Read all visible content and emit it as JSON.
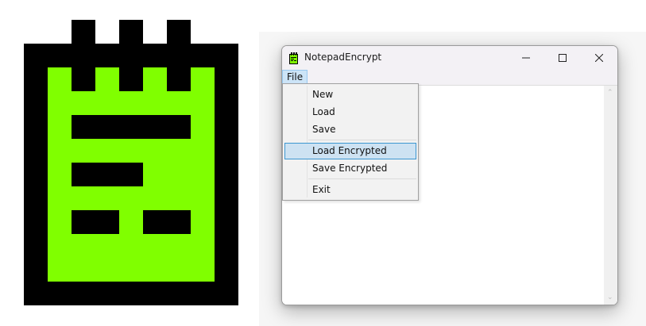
{
  "window": {
    "title": "NotepadEncrypt",
    "icon": "notepad-icon",
    "controls": [
      "minimize-icon",
      "maximize-icon",
      "close-icon"
    ]
  },
  "menubar": {
    "file_label": "File"
  },
  "file_menu": {
    "items": [
      {
        "label": "New"
      },
      {
        "label": "Load"
      },
      {
        "label": "Save"
      },
      {
        "label": "Load Encrypted"
      },
      {
        "label": "Save Encrypted"
      },
      {
        "label": "Exit"
      }
    ],
    "highlighted": "Load Encrypted"
  },
  "colors": {
    "logo_green": "#80ff00",
    "logo_black": "#000000",
    "highlight": "#cde2f2",
    "highlight_border": "#3c96d0",
    "menu_bg": "#f2f2f2",
    "titlebar_bg": "#f3f1f5"
  },
  "logo": {
    "icon": "notepad-logo-icon"
  }
}
